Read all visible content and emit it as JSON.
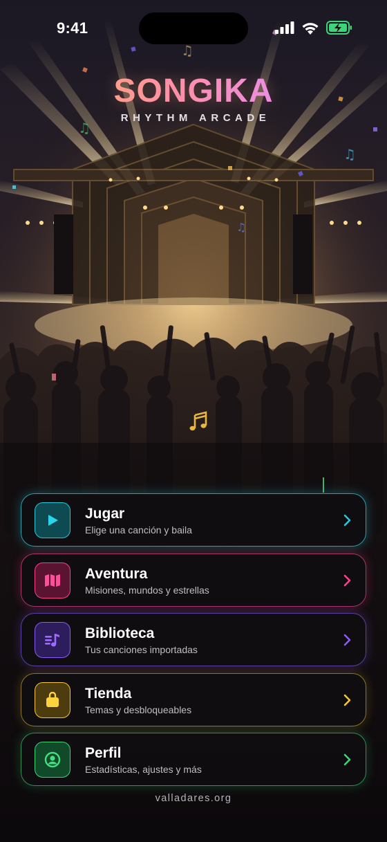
{
  "status_bar": {
    "time": "9:41"
  },
  "logo": {
    "title": "SONGIKA",
    "subtitle": "RHYTHM ARCADE"
  },
  "menu": [
    {
      "label": "Jugar",
      "subtitle": "Elige una canción y baila",
      "icon": "play-icon",
      "color": "#27c7d8"
    },
    {
      "label": "Aventura",
      "subtitle": "Misiones, mundos y estrellas",
      "icon": "map-icon",
      "color": "#ff3f8e"
    },
    {
      "label": "Biblioteca",
      "subtitle": "Tus canciones importadas",
      "icon": "music-library-icon",
      "color": "#8a5cf5"
    },
    {
      "label": "Tienda",
      "subtitle": "Temas y desbloqueables",
      "icon": "shopping-bag-icon",
      "color": "#f7c531"
    },
    {
      "label": "Perfil",
      "subtitle": "Estadísticas, ajustes y más",
      "icon": "profile-icon",
      "color": "#3ad675"
    }
  ],
  "footer": {
    "link": "valladares.org"
  }
}
